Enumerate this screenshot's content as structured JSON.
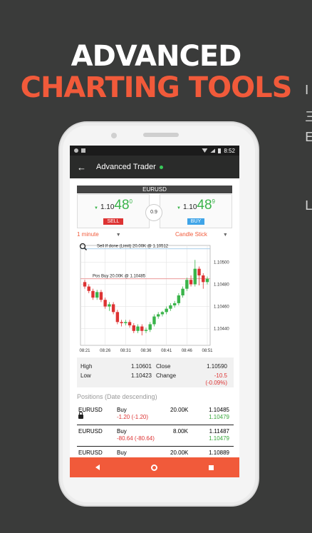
{
  "headline": {
    "line1": "ADVANCED",
    "line2": "CHARTING TOOLS"
  },
  "edge_glyphs": [
    "I",
    "三",
    "E",
    "L"
  ],
  "status_bar": {
    "time": "8:52"
  },
  "app_bar": {
    "title": "Advanced Trader"
  },
  "instrument": {
    "pair": "EURUSD",
    "spread": "0.9"
  },
  "sell": {
    "small": "1.10",
    "big": "48",
    "sup": "0",
    "label": "SELL"
  },
  "buy": {
    "small": "1.10",
    "big": "48",
    "sup": "9",
    "label": "BUY"
  },
  "selectors": {
    "interval": "1 minute",
    "chart_style": "Candle Stick"
  },
  "chart_data": {
    "type": "candlestick",
    "annotations": [
      "Sell If done (Limit) 20.00K @ 1.10512",
      "Pos Buy 20.00K @ 1.10485"
    ],
    "annotation_levels": [
      1.10512,
      1.10485
    ],
    "x_ticks": [
      "08:21",
      "08:26",
      "08:31",
      "08:36",
      "08:41",
      "08:46",
      "08:51"
    ],
    "y_ticks": [
      "1.10500",
      "1.10480",
      "1.10460",
      "1.10440"
    ],
    "y_tick_values": [
      1.105,
      1.1048,
      1.1046,
      1.1044
    ],
    "ylim": [
      1.10425,
      1.10515
    ],
    "candles": [
      {
        "o": 1.10482,
        "c": 1.10478,
        "h": 1.10484,
        "l": 1.10476
      },
      {
        "o": 1.10478,
        "c": 1.10474,
        "h": 1.1048,
        "l": 1.10472
      },
      {
        "o": 1.10474,
        "c": 1.10468,
        "h": 1.10476,
        "l": 1.10466
      },
      {
        "o": 1.10468,
        "c": 1.10473,
        "h": 1.10475,
        "l": 1.10466
      },
      {
        "o": 1.10473,
        "c": 1.10466,
        "h": 1.10475,
        "l": 1.10464
      },
      {
        "o": 1.10466,
        "c": 1.1046,
        "h": 1.10468,
        "l": 1.10458
      },
      {
        "o": 1.1046,
        "c": 1.10462,
        "h": 1.10464,
        "l": 1.10456
      },
      {
        "o": 1.10462,
        "c": 1.10455,
        "h": 1.10464,
        "l": 1.10453
      },
      {
        "o": 1.10455,
        "c": 1.10446,
        "h": 1.10457,
        "l": 1.10444
      },
      {
        "o": 1.10446,
        "c": 1.10445,
        "h": 1.10448,
        "l": 1.10442
      },
      {
        "o": 1.10445,
        "c": 1.10446,
        "h": 1.10448,
        "l": 1.10443
      },
      {
        "o": 1.10446,
        "c": 1.10443,
        "h": 1.10448,
        "l": 1.10441
      },
      {
        "o": 1.10443,
        "c": 1.10438,
        "h": 1.10445,
        "l": 1.10436
      },
      {
        "o": 1.10438,
        "c": 1.10442,
        "h": 1.10444,
        "l": 1.10436
      },
      {
        "o": 1.10442,
        "c": 1.10438,
        "h": 1.10444,
        "l": 1.10434
      },
      {
        "o": 1.10438,
        "c": 1.10439,
        "h": 1.10441,
        "l": 1.10436
      },
      {
        "o": 1.10439,
        "c": 1.10444,
        "h": 1.10446,
        "l": 1.10437
      },
      {
        "o": 1.10444,
        "c": 1.10451,
        "h": 1.10453,
        "l": 1.10442
      },
      {
        "o": 1.10451,
        "c": 1.10453,
        "h": 1.10455,
        "l": 1.10449
      },
      {
        "o": 1.10453,
        "c": 1.10455,
        "h": 1.10456,
        "l": 1.10451
      },
      {
        "o": 1.10455,
        "c": 1.10458,
        "h": 1.1046,
        "l": 1.10453
      },
      {
        "o": 1.10458,
        "c": 1.10461,
        "h": 1.10463,
        "l": 1.10456
      },
      {
        "o": 1.10461,
        "c": 1.10463,
        "h": 1.10465,
        "l": 1.10459
      },
      {
        "o": 1.10463,
        "c": 1.1047,
        "h": 1.10472,
        "l": 1.10461
      },
      {
        "o": 1.1047,
        "c": 1.10476,
        "h": 1.10478,
        "l": 1.10468
      },
      {
        "o": 1.10476,
        "c": 1.10484,
        "h": 1.10486,
        "l": 1.10474
      },
      {
        "o": 1.10484,
        "c": 1.1048,
        "h": 1.10488,
        "l": 1.10478
      },
      {
        "o": 1.1048,
        "c": 1.10494,
        "h": 1.10502,
        "l": 1.10478
      },
      {
        "o": 1.10494,
        "c": 1.10488,
        "h": 1.10496,
        "l": 1.10479
      },
      {
        "o": 1.10488,
        "c": 1.10482,
        "h": 1.1049,
        "l": 1.10476
      },
      {
        "o": 1.10482,
        "c": 1.10485,
        "h": 1.10487,
        "l": 1.1048
      }
    ],
    "colors": {
      "up": "#3ab44a",
      "down": "#dd3333"
    }
  },
  "stats": {
    "high_label": "High",
    "high_value": "1.10601",
    "close_label": "Close",
    "close_value": "1.10590",
    "low_label": "Low",
    "low_value": "1.10423",
    "change_label": "Change",
    "change_value": "-10.5",
    "change_pct": "(-0.09%)"
  },
  "positions": {
    "title": "Positions (Date descending)",
    "rows": [
      {
        "pair": "EURUSD",
        "side": "Buy",
        "pnl": "-1.20 (-1.20)",
        "amount": "20.00K",
        "open": "1.10485",
        "current": "1.10479",
        "locked": true
      },
      {
        "pair": "EURUSD",
        "side": "Buy",
        "pnl": "-80.64 (-80.64)",
        "amount": "8.00K",
        "open": "1.11487",
        "current": "1.10479",
        "locked": false
      },
      {
        "pair": "EURUSD",
        "side": "Buy",
        "pnl": "",
        "amount": "20.00K",
        "open": "1.10889",
        "current": "",
        "locked": false
      }
    ]
  },
  "colors": {
    "accent": "#f15a3a",
    "sell": "#dd3333",
    "buy": "#3fa4e8",
    "up": "#3ab44a"
  }
}
